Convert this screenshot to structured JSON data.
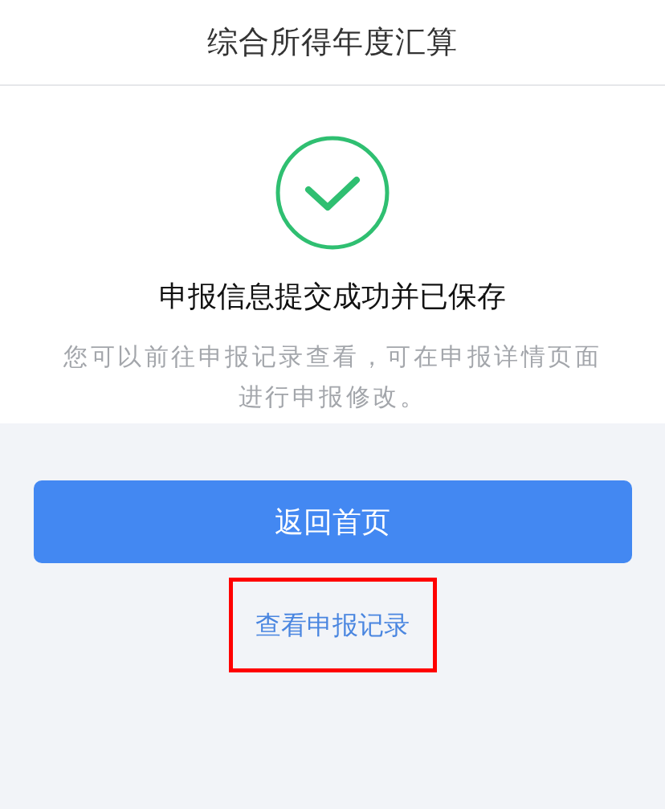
{
  "header": {
    "title": "综合所得年度汇算"
  },
  "result": {
    "success": true,
    "heading": "申报信息提交成功并已保存",
    "description": "您可以前往申报记录查看，可在申报详情页面进行申报修改。"
  },
  "primary_button": {
    "label": "返回首页"
  },
  "link": {
    "label": "查看申报记录",
    "highlighted": true
  }
}
